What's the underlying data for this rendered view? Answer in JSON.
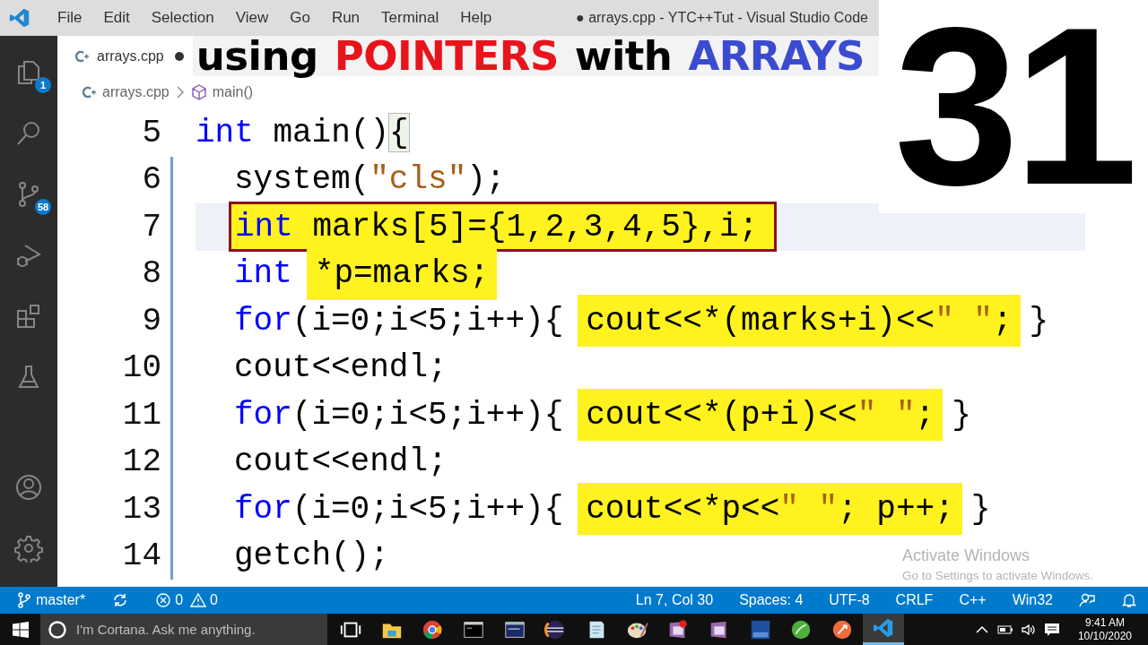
{
  "title_bar": {
    "menu": [
      "File",
      "Edit",
      "Selection",
      "View",
      "Go",
      "Run",
      "Terminal",
      "Help"
    ],
    "title": "● arrays.cpp - YTC++Tut - Visual Studio Code"
  },
  "activity_bar": {
    "items": [
      {
        "kind": "explorer",
        "badge": "1"
      },
      {
        "kind": "search"
      },
      {
        "kind": "source-control",
        "badge": "58"
      },
      {
        "kind": "run"
      },
      {
        "kind": "extensions"
      },
      {
        "kind": "testing"
      }
    ],
    "bottom": [
      {
        "kind": "account"
      },
      {
        "kind": "settings"
      }
    ]
  },
  "tab": {
    "label": "arrays.cpp",
    "modified": true
  },
  "video_title": [
    {
      "text": "using",
      "color": "#000000"
    },
    {
      "text": "POINTERS",
      "color": "#e8141c"
    },
    {
      "text": "with",
      "color": "#000000"
    },
    {
      "text": "ARRAYS",
      "color": "#3b4bd0"
    }
  ],
  "episode_number": "31",
  "breadcrumb": [
    "arrays.cpp",
    "main()"
  ],
  "code": [
    {
      "number": "5",
      "current": false,
      "groups": [
        {
          "kind": "plain",
          "tokens": [
            {
              "text": "int",
              "kind": "keyword"
            },
            {
              "text": " main()",
              "kind": "plain"
            }
          ]
        },
        {
          "kind": "bracket",
          "tokens": [
            {
              "text": "{",
              "kind": "plain"
            }
          ]
        }
      ],
      "children": [
        {
          "number": "6",
          "current": false,
          "groups": [
            {
              "kind": "plain",
              "tokens": [
                {
                  "text": "system(",
                  "kind": "plain"
                },
                {
                  "text": "\"cls\"",
                  "kind": "string"
                },
                {
                  "text": ");",
                  "kind": "plain"
                }
              ]
            }
          ]
        },
        {
          "number": "7",
          "current": true,
          "groups": [
            {
              "kind": "boxed",
              "tokens": [
                {
                  "text": "int",
                  "kind": "keyword"
                },
                {
                  "text": " marks[5]={1,2,3,4,5},i;",
                  "kind": "plain"
                }
              ]
            }
          ]
        },
        {
          "number": "8",
          "current": false,
          "groups": [
            {
              "kind": "plain",
              "tokens": [
                {
                  "text": "int",
                  "kind": "keyword"
                }
              ]
            },
            {
              "kind": "highlighted",
              "tokens": [
                {
                  "text": "*p=marks;",
                  "kind": "plain"
                }
              ]
            }
          ]
        },
        {
          "number": "9",
          "current": false,
          "groups": [
            {
              "kind": "plain",
              "tokens": [
                {
                  "text": "for",
                  "kind": "keyword"
                },
                {
                  "text": "(i=0;i<5;i++){",
                  "kind": "plain"
                }
              ]
            },
            {
              "kind": "highlighted",
              "tokens": [
                {
                  "text": "cout<<*(marks+i)<<",
                  "kind": "plain"
                },
                {
                  "text": "\" \"",
                  "kind": "string"
                },
                {
                  "text": ";",
                  "kind": "plain"
                }
              ]
            },
            {
              "kind": "plain",
              "tokens": [
                {
                  "text": "}",
                  "kind": "plain"
                }
              ]
            }
          ]
        },
        {
          "number": "10",
          "current": false,
          "groups": [
            {
              "kind": "plain",
              "tokens": [
                {
                  "text": "cout<<endl;",
                  "kind": "plain"
                }
              ]
            }
          ]
        },
        {
          "number": "11",
          "current": false,
          "groups": [
            {
              "kind": "plain",
              "tokens": [
                {
                  "text": "for",
                  "kind": "keyword"
                },
                {
                  "text": "(i=0;i<5;i++){",
                  "kind": "plain"
                }
              ]
            },
            {
              "kind": "highlighted",
              "tokens": [
                {
                  "text": "cout<<*(p+i)<<",
                  "kind": "plain"
                },
                {
                  "text": "\" \"",
                  "kind": "string"
                },
                {
                  "text": ";",
                  "kind": "plain"
                }
              ]
            },
            {
              "kind": "plain",
              "tokens": [
                {
                  "text": "}",
                  "kind": "plain"
                }
              ]
            }
          ]
        },
        {
          "number": "12",
          "current": false,
          "groups": [
            {
              "kind": "plain",
              "tokens": [
                {
                  "text": "cout<<endl;",
                  "kind": "plain"
                }
              ]
            }
          ]
        },
        {
          "number": "13",
          "current": false,
          "groups": [
            {
              "kind": "plain",
              "tokens": [
                {
                  "text": "for",
                  "kind": "keyword"
                },
                {
                  "text": "(i=0;i<5;i++){",
                  "kind": "plain"
                }
              ]
            },
            {
              "kind": "highlighted",
              "tokens": [
                {
                  "text": "cout<<*p<<",
                  "kind": "plain"
                },
                {
                  "text": "\" \"",
                  "kind": "string"
                },
                {
                  "text": "; p++;",
                  "kind": "plain"
                }
              ]
            },
            {
              "kind": "plain",
              "tokens": [
                {
                  "text": "}",
                  "kind": "plain"
                }
              ]
            }
          ]
        },
        {
          "number": "14",
          "current": false,
          "groups": [
            {
              "kind": "plain",
              "tokens": [
                {
                  "text": "getch();",
                  "kind": "plain"
                }
              ]
            }
          ]
        }
      ]
    }
  ],
  "activation_notice": {
    "title": "Activate Windows",
    "message": "Go to Settings to activate Windows."
  },
  "status_bar": {
    "branch": "master*",
    "errors": "0",
    "warnings": "0",
    "right": [
      "Ln 7, Col 30",
      "Spaces: 4",
      "UTF-8",
      "CRLF",
      "C++",
      "Win32"
    ]
  },
  "taskbar": {
    "search_placeholder": "I'm Cortana. Ask me anything.",
    "apps": [
      {
        "kind": "task-view",
        "selected": false
      },
      {
        "kind": "folder",
        "selected": false
      },
      {
        "kind": "browser",
        "selected": false
      },
      {
        "kind": "terminal",
        "selected": false
      },
      {
        "kind": "window",
        "selected": false
      },
      {
        "kind": "ring",
        "selected": false
      },
      {
        "kind": "notepad",
        "selected": false
      },
      {
        "kind": "palette",
        "selected": false
      },
      {
        "kind": "note-alert",
        "selected": false
      },
      {
        "kind": "note",
        "selected": false
      },
      {
        "kind": "dev",
        "selected": false
      },
      {
        "kind": "leaf",
        "selected": false
      },
      {
        "kind": "rocket",
        "selected": false
      },
      {
        "kind": "vscode",
        "selected": true
      }
    ],
    "time": "9:41 AM",
    "date": "10/10/2020"
  }
}
